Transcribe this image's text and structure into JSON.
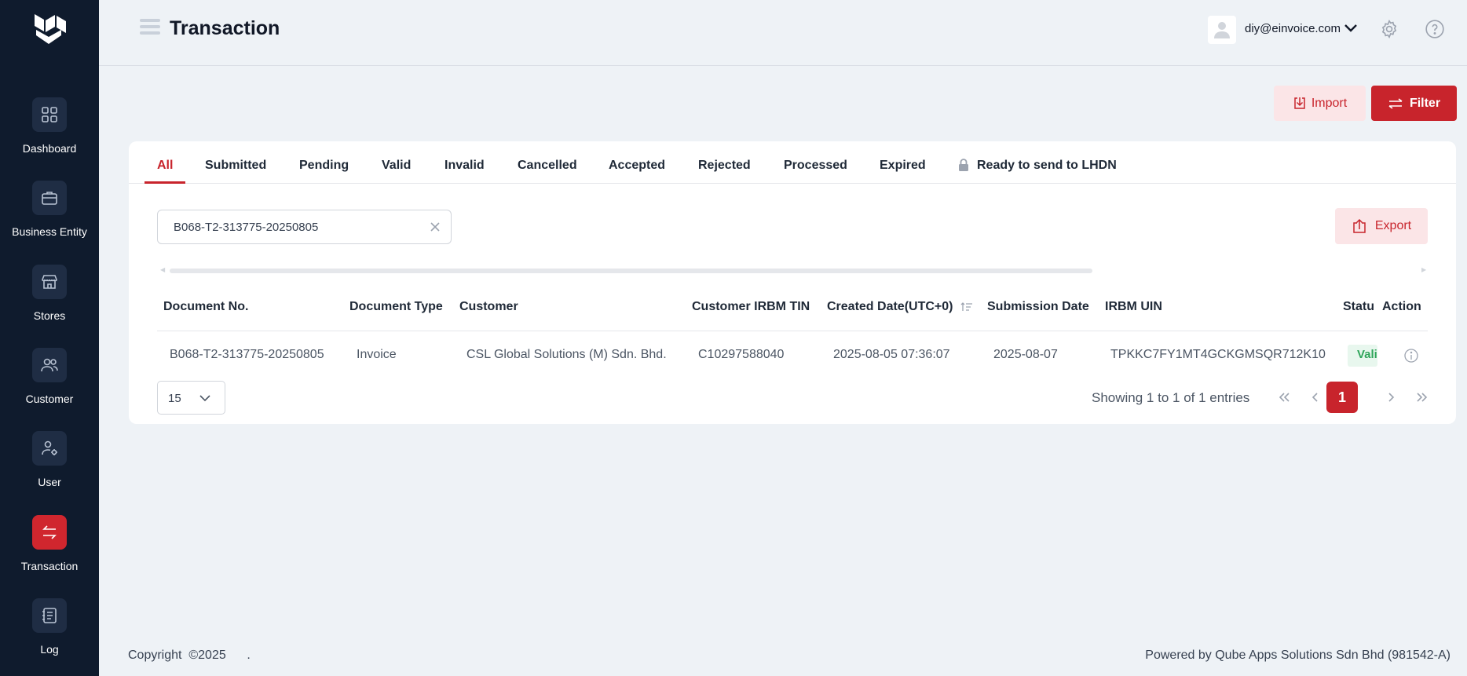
{
  "header": {
    "title": "Transaction",
    "user_email": "diy@einvoice.com"
  },
  "sidebar": {
    "items": [
      {
        "label": "Dashboard",
        "icon": "grid-icon"
      },
      {
        "label": "Business Entity",
        "icon": "briefcase-icon"
      },
      {
        "label": "Stores",
        "icon": "store-icon"
      },
      {
        "label": "Customer",
        "icon": "users-icon"
      },
      {
        "label": "User",
        "icon": "user-settings-icon"
      },
      {
        "label": "Transaction",
        "icon": "transfer-icon",
        "active": true
      },
      {
        "label": "Log",
        "icon": "log-icon"
      }
    ]
  },
  "actions": {
    "import_label": "Import",
    "filter_label": "Filter",
    "export_label": "Export"
  },
  "tabs": [
    {
      "label": "All",
      "active": true
    },
    {
      "label": "Submitted"
    },
    {
      "label": "Pending"
    },
    {
      "label": "Valid"
    },
    {
      "label": "Invalid"
    },
    {
      "label": "Cancelled"
    },
    {
      "label": "Accepted"
    },
    {
      "label": "Rejected"
    },
    {
      "label": "Processed"
    },
    {
      "label": "Expired"
    },
    {
      "label": "Ready to send to LHDN",
      "locked": true
    }
  ],
  "search": {
    "value": "B068-T2-313775-20250805"
  },
  "table": {
    "columns": [
      "Document No.",
      "Document Type",
      "Customer",
      "Customer IRBM TIN",
      "Created Date(UTC+0)",
      "Submission Date",
      "IRBM UIN",
      "Status",
      "Action"
    ],
    "rows": [
      {
        "document_no": "B068-T2-313775-20250805",
        "document_type": "Invoice",
        "customer": "CSL Global Solutions (M) Sdn. Bhd.",
        "customer_tin": "C10297588040",
        "created_date": "2025-08-05 07:36:07",
        "submission_date": "2025-08-07",
        "irbm_uin": "TPKKC7FY1MT4GCKGMSQR712K10",
        "status": "Valid"
      }
    ]
  },
  "pagination": {
    "page_size": "15",
    "showing_text": "Showing 1 to 1 of 1 entries",
    "current_page": "1"
  },
  "footer": {
    "copyright": "Copyright  ©2025      .",
    "powered_by": "Powered by Qube Apps Solutions Sdn Bhd (981542-A)"
  },
  "colors": {
    "brand_red": "#c8242c",
    "sidebar_bg": "#0f1b2d",
    "status_valid": "#2fa55a"
  }
}
